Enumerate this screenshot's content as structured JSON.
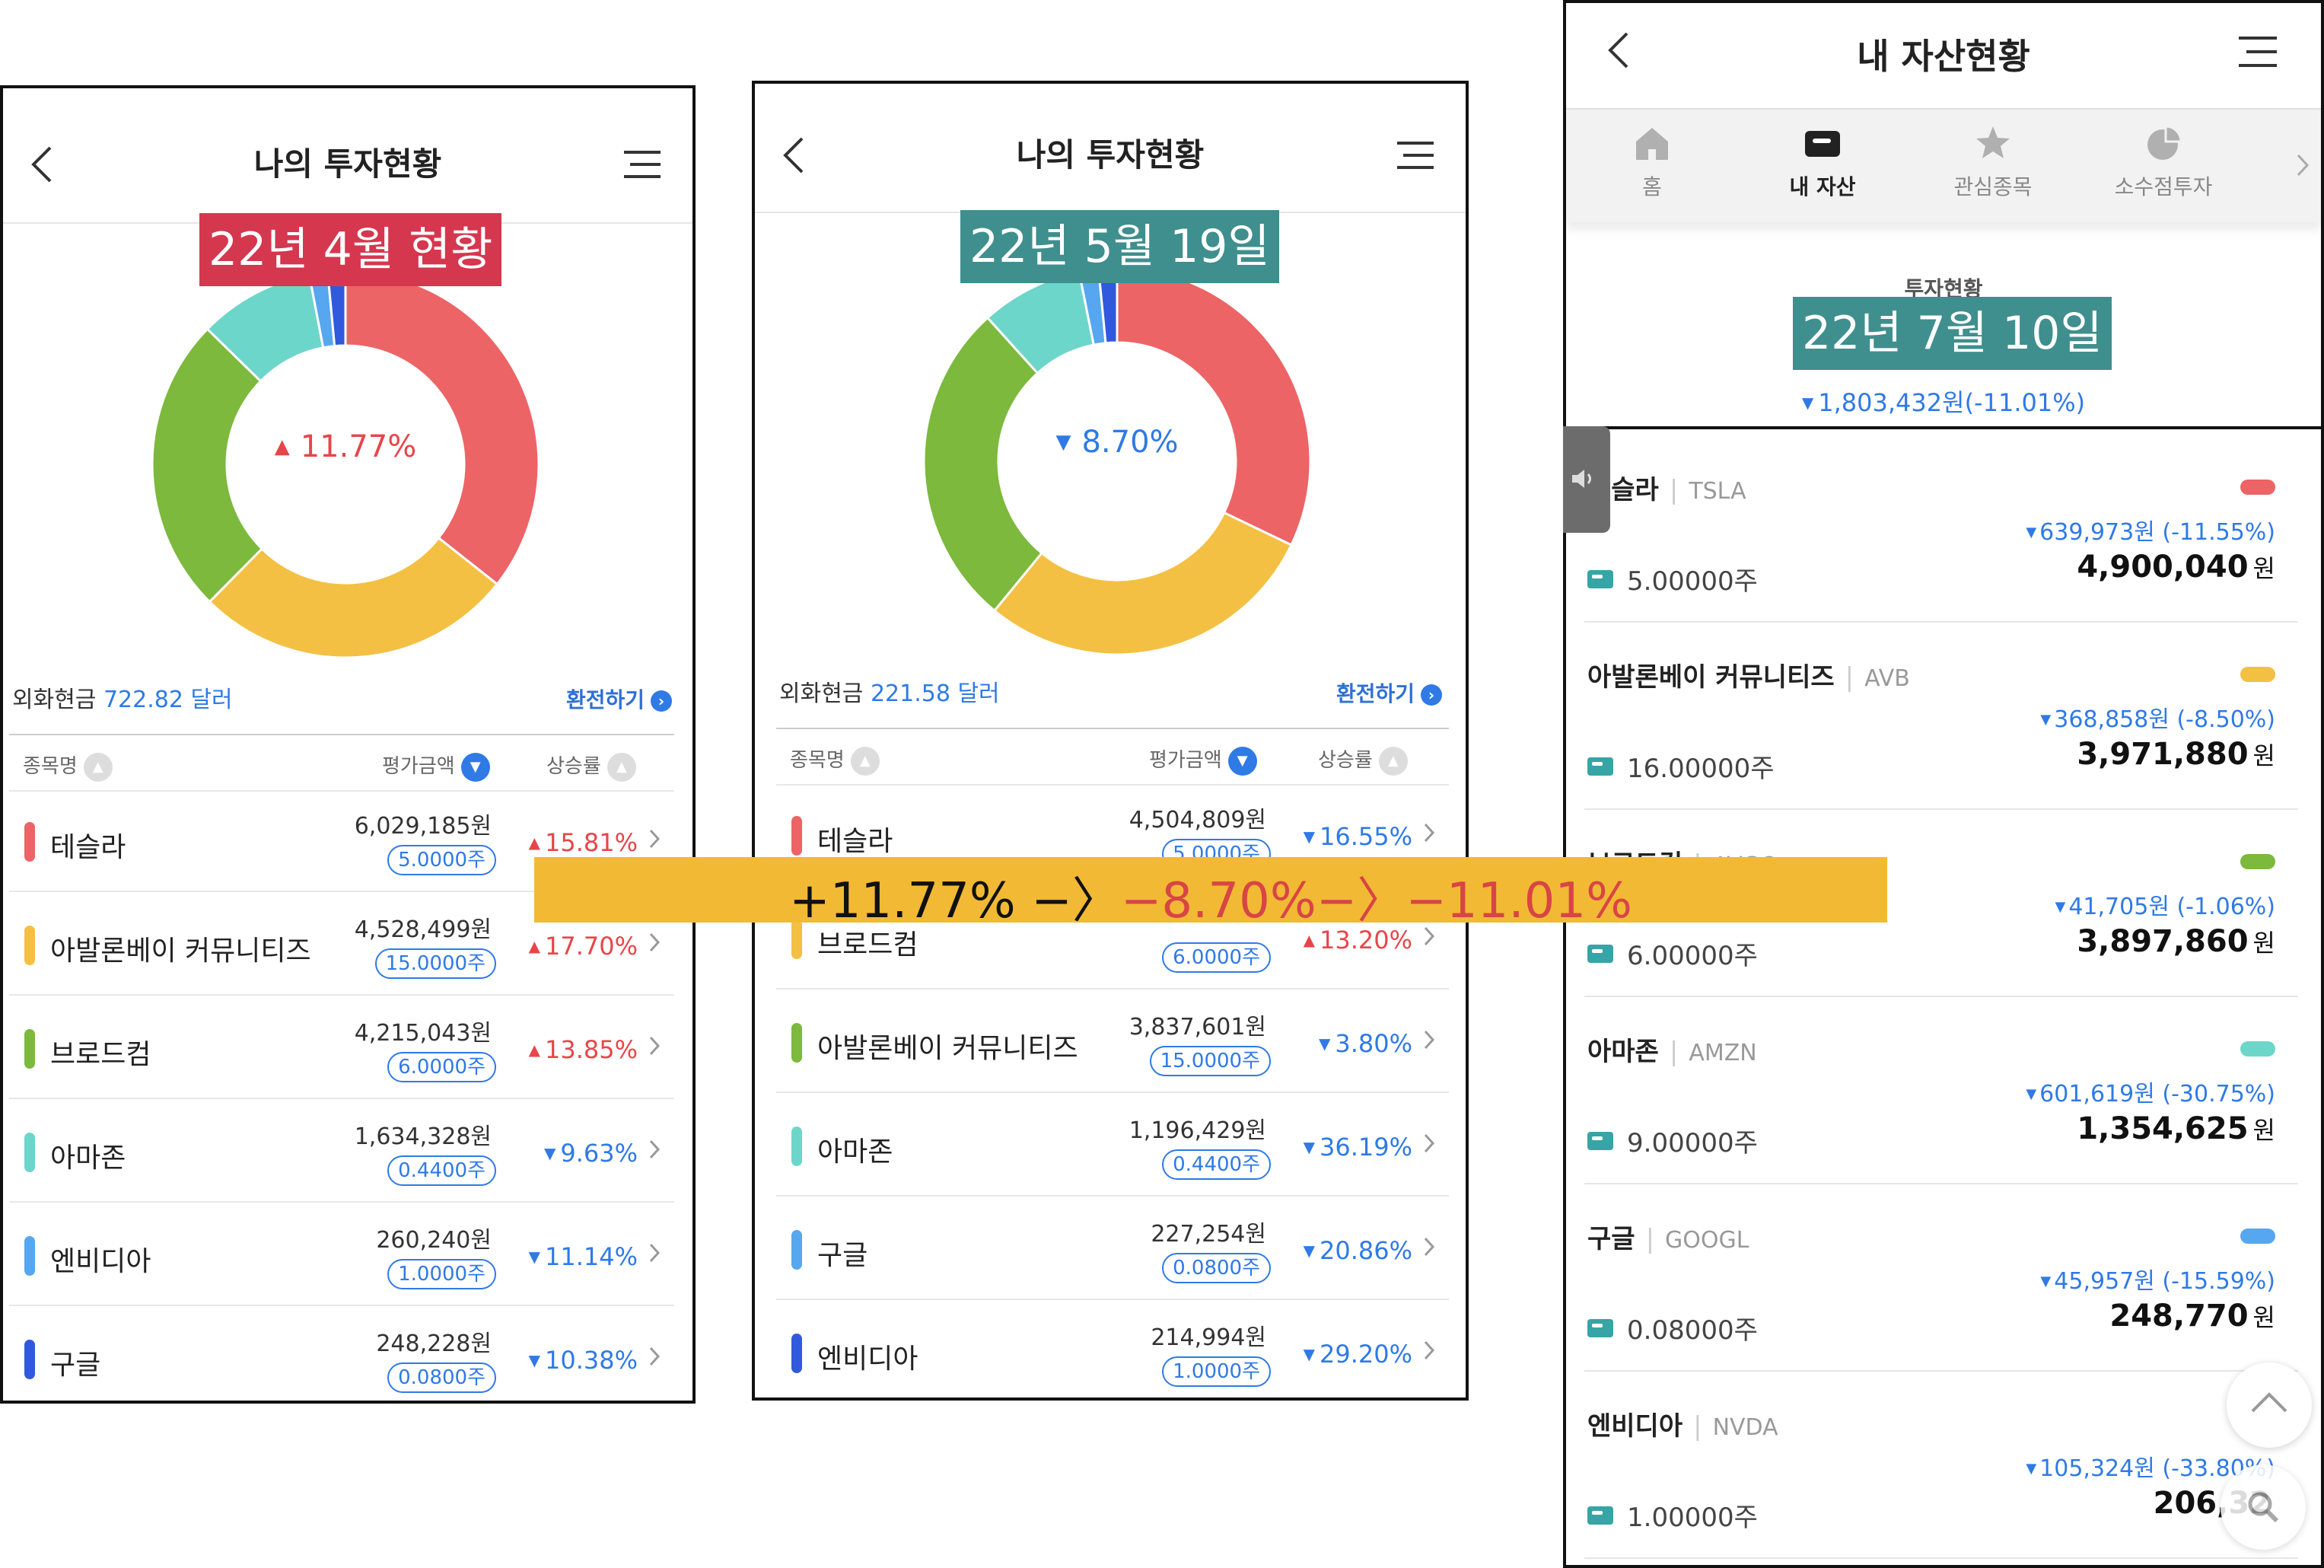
{
  "colors": {
    "up": "#e8454a",
    "down": "#2f7ae5",
    "tesla": "#ec6466",
    "avb": "#f4c043",
    "broadcom": "#7cb93c",
    "amazon": "#6dd6ca",
    "nvidia": "#56a7ef",
    "google": "#3159dd",
    "badge_april": "#d5374e",
    "badge_may": "#3f8f8e",
    "badge_july": "#3f8f8e",
    "banner": "#f2b935"
  },
  "panel_april": {
    "title": "나의 투자현황",
    "badge": "22년 4월 현황",
    "center_rate": "11.77%",
    "center_direction": "up",
    "cash_label": "외화현금",
    "cash_amount": "722.82 달러",
    "exchange_label": "환전하기",
    "columns": [
      "종목명",
      "평가금액",
      "상승률"
    ],
    "donut_shares": [
      {
        "name": "테슬라",
        "value": 6029185,
        "color_key": "tesla"
      },
      {
        "name": "아발론베이 커뮤니티즈",
        "value": 4528499,
        "color_key": "avb"
      },
      {
        "name": "브로드컴",
        "value": 4215043,
        "color_key": "broadcom"
      },
      {
        "name": "아마존",
        "value": 1634328,
        "color_key": "amazon"
      },
      {
        "name": "엔비디아",
        "value": 260240,
        "color_key": "nvidia"
      },
      {
        "name": "구글",
        "value": 248228,
        "color_key": "google"
      }
    ],
    "rows": [
      {
        "name": "테슬라",
        "value": "6,029,185원",
        "qty": "5.0000주",
        "rate": "15.81%",
        "dir": "up",
        "color_key": "tesla"
      },
      {
        "name": "아발론베이 커뮤니티즈",
        "value": "4,528,499원",
        "qty": "15.0000주",
        "rate": "17.70%",
        "dir": "up",
        "color_key": "avb"
      },
      {
        "name": "브로드컴",
        "value": "4,215,043원",
        "qty": "6.0000주",
        "rate": "13.85%",
        "dir": "up",
        "color_key": "broadcom"
      },
      {
        "name": "아마존",
        "value": "1,634,328원",
        "qty": "0.4400주",
        "rate": "9.63%",
        "dir": "down",
        "color_key": "amazon"
      },
      {
        "name": "엔비디아",
        "value": "260,240원",
        "qty": "1.0000주",
        "rate": "11.14%",
        "dir": "down",
        "color_key": "nvidia"
      },
      {
        "name": "구글",
        "value": "248,228원",
        "qty": "0.0800주",
        "rate": "10.38%",
        "dir": "down",
        "color_key": "google"
      }
    ]
  },
  "panel_may": {
    "title": "나의 투자현황",
    "badge": "22년 5월 19일",
    "center_rate": "8.70%",
    "center_direction": "down",
    "cash_label": "외화현금",
    "cash_amount": "221.58 달러",
    "exchange_label": "환전하기",
    "columns": [
      "종목명",
      "평가금액",
      "상승률"
    ],
    "donut_shares": [
      {
        "name": "테슬라",
        "value": 4504809,
        "color_key": "tesla"
      },
      {
        "name": "브로드컴",
        "value": 4040000,
        "color_key": "avb"
      },
      {
        "name": "아발론베이 커뮤니티즈",
        "value": 3837601,
        "color_key": "broadcom"
      },
      {
        "name": "아마존",
        "value": 1196429,
        "color_key": "amazon"
      },
      {
        "name": "구글",
        "value": 227254,
        "color_key": "nvidia"
      },
      {
        "name": "엔비디아",
        "value": 214994,
        "color_key": "google"
      }
    ],
    "rows": [
      {
        "name": "테슬라",
        "value": "4,504,809원",
        "qty": "5.0000주",
        "rate": "16.55%",
        "dir": "down",
        "color_key": "tesla"
      },
      {
        "name": "브로드컴",
        "value": "",
        "qty": "6.0000주",
        "rate": "13.20%",
        "dir": "up",
        "color_key": "avb"
      },
      {
        "name": "아발론베이 커뮤니티즈",
        "value": "3,837,601원",
        "qty": "15.0000주",
        "rate": "3.80%",
        "dir": "down",
        "color_key": "broadcom"
      },
      {
        "name": "아마존",
        "value": "1,196,429원",
        "qty": "0.4400주",
        "rate": "36.19%",
        "dir": "down",
        "color_key": "amazon"
      },
      {
        "name": "구글",
        "value": "227,254원",
        "qty": "0.0800주",
        "rate": "20.86%",
        "dir": "down",
        "color_key": "nvidia"
      },
      {
        "name": "엔비디아",
        "value": "214,994원",
        "qty": "1.0000주",
        "rate": "29.20%",
        "dir": "down",
        "color_key": "google"
      }
    ]
  },
  "panel_july": {
    "title": "내 자산현황",
    "tabs": [
      "홈",
      "내 자산",
      "관심종목",
      "소수점투자"
    ],
    "active_tab": 1,
    "summary_label": "투자현황",
    "badge": "22년 7월 10일",
    "summary_change": "1,803,432원(-11.01%)",
    "stocks": [
      {
        "name": "테슬라",
        "ticker": "TSLA",
        "change": "639,973원 (-11.55%)",
        "amount": "4,900,040",
        "unit": "원",
        "shares": "5.00000주",
        "color_key": "tesla"
      },
      {
        "name": "아발론베이 커뮤니티즈",
        "ticker": "AVB",
        "change": "368,858원 (-8.50%)",
        "amount": "3,971,880",
        "unit": "원",
        "shares": "16.00000주",
        "color_key": "avb"
      },
      {
        "name": "브로드컴",
        "ticker": "AVGO",
        "change": "41,705원 (-1.06%)",
        "amount": "3,897,860",
        "unit": "원",
        "shares": "6.00000주",
        "color_key": "broadcom"
      },
      {
        "name": "아마존",
        "ticker": "AMZN",
        "change": "601,619원 (-30.75%)",
        "amount": "1,354,625",
        "unit": "원",
        "shares": "9.00000주",
        "color_key": "amazon"
      },
      {
        "name": "구글",
        "ticker": "GOOGL",
        "change": "45,957원 (-15.59%)",
        "amount": "248,770",
        "unit": "원",
        "shares": "0.08000주",
        "color_key": "nvidia"
      },
      {
        "name": "엔비디아",
        "ticker": "NVDA",
        "change": "105,324원 (-33.80%)",
        "amount": "206,32",
        "unit": "",
        "shares": "1.00000주",
        "color_key": "nvidia"
      }
    ]
  },
  "banner": {
    "part1": "+11.77% −〉",
    "part2": "−8.70%−〉−11.01%"
  }
}
